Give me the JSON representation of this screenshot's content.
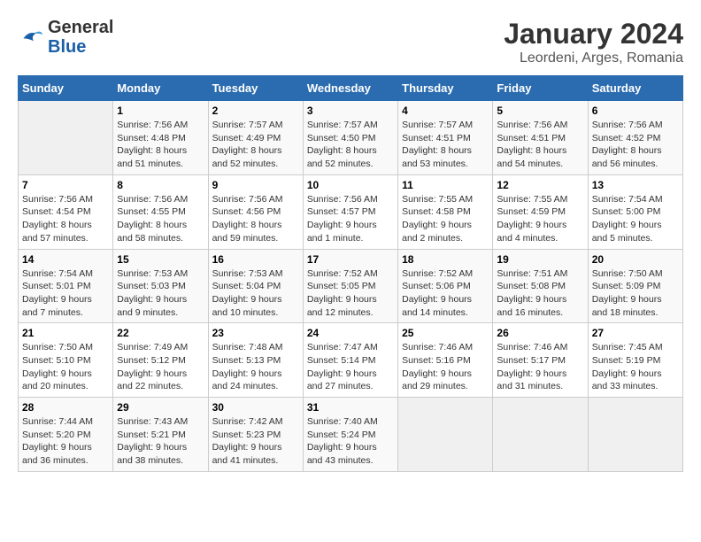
{
  "app": {
    "logo_line1": "General",
    "logo_line2": "Blue",
    "title": "January 2024",
    "subtitle": "Leordeni, Arges, Romania"
  },
  "calendar": {
    "headers": [
      "Sunday",
      "Monday",
      "Tuesday",
      "Wednesday",
      "Thursday",
      "Friday",
      "Saturday"
    ],
    "weeks": [
      [
        {
          "day": "",
          "info": ""
        },
        {
          "day": "1",
          "info": "Sunrise: 7:56 AM\nSunset: 4:48 PM\nDaylight: 8 hours\nand 51 minutes."
        },
        {
          "day": "2",
          "info": "Sunrise: 7:57 AM\nSunset: 4:49 PM\nDaylight: 8 hours\nand 52 minutes."
        },
        {
          "day": "3",
          "info": "Sunrise: 7:57 AM\nSunset: 4:50 PM\nDaylight: 8 hours\nand 52 minutes."
        },
        {
          "day": "4",
          "info": "Sunrise: 7:57 AM\nSunset: 4:51 PM\nDaylight: 8 hours\nand 53 minutes."
        },
        {
          "day": "5",
          "info": "Sunrise: 7:56 AM\nSunset: 4:51 PM\nDaylight: 8 hours\nand 54 minutes."
        },
        {
          "day": "6",
          "info": "Sunrise: 7:56 AM\nSunset: 4:52 PM\nDaylight: 8 hours\nand 56 minutes."
        }
      ],
      [
        {
          "day": "7",
          "info": "Sunrise: 7:56 AM\nSunset: 4:54 PM\nDaylight: 8 hours\nand 57 minutes."
        },
        {
          "day": "8",
          "info": "Sunrise: 7:56 AM\nSunset: 4:55 PM\nDaylight: 8 hours\nand 58 minutes."
        },
        {
          "day": "9",
          "info": "Sunrise: 7:56 AM\nSunset: 4:56 PM\nDaylight: 8 hours\nand 59 minutes."
        },
        {
          "day": "10",
          "info": "Sunrise: 7:56 AM\nSunset: 4:57 PM\nDaylight: 9 hours\nand 1 minute."
        },
        {
          "day": "11",
          "info": "Sunrise: 7:55 AM\nSunset: 4:58 PM\nDaylight: 9 hours\nand 2 minutes."
        },
        {
          "day": "12",
          "info": "Sunrise: 7:55 AM\nSunset: 4:59 PM\nDaylight: 9 hours\nand 4 minutes."
        },
        {
          "day": "13",
          "info": "Sunrise: 7:54 AM\nSunset: 5:00 PM\nDaylight: 9 hours\nand 5 minutes."
        }
      ],
      [
        {
          "day": "14",
          "info": "Sunrise: 7:54 AM\nSunset: 5:01 PM\nDaylight: 9 hours\nand 7 minutes."
        },
        {
          "day": "15",
          "info": "Sunrise: 7:53 AM\nSunset: 5:03 PM\nDaylight: 9 hours\nand 9 minutes."
        },
        {
          "day": "16",
          "info": "Sunrise: 7:53 AM\nSunset: 5:04 PM\nDaylight: 9 hours\nand 10 minutes."
        },
        {
          "day": "17",
          "info": "Sunrise: 7:52 AM\nSunset: 5:05 PM\nDaylight: 9 hours\nand 12 minutes."
        },
        {
          "day": "18",
          "info": "Sunrise: 7:52 AM\nSunset: 5:06 PM\nDaylight: 9 hours\nand 14 minutes."
        },
        {
          "day": "19",
          "info": "Sunrise: 7:51 AM\nSunset: 5:08 PM\nDaylight: 9 hours\nand 16 minutes."
        },
        {
          "day": "20",
          "info": "Sunrise: 7:50 AM\nSunset: 5:09 PM\nDaylight: 9 hours\nand 18 minutes."
        }
      ],
      [
        {
          "day": "21",
          "info": "Sunrise: 7:50 AM\nSunset: 5:10 PM\nDaylight: 9 hours\nand 20 minutes."
        },
        {
          "day": "22",
          "info": "Sunrise: 7:49 AM\nSunset: 5:12 PM\nDaylight: 9 hours\nand 22 minutes."
        },
        {
          "day": "23",
          "info": "Sunrise: 7:48 AM\nSunset: 5:13 PM\nDaylight: 9 hours\nand 24 minutes."
        },
        {
          "day": "24",
          "info": "Sunrise: 7:47 AM\nSunset: 5:14 PM\nDaylight: 9 hours\nand 27 minutes."
        },
        {
          "day": "25",
          "info": "Sunrise: 7:46 AM\nSunset: 5:16 PM\nDaylight: 9 hours\nand 29 minutes."
        },
        {
          "day": "26",
          "info": "Sunrise: 7:46 AM\nSunset: 5:17 PM\nDaylight: 9 hours\nand 31 minutes."
        },
        {
          "day": "27",
          "info": "Sunrise: 7:45 AM\nSunset: 5:19 PM\nDaylight: 9 hours\nand 33 minutes."
        }
      ],
      [
        {
          "day": "28",
          "info": "Sunrise: 7:44 AM\nSunset: 5:20 PM\nDaylight: 9 hours\nand 36 minutes."
        },
        {
          "day": "29",
          "info": "Sunrise: 7:43 AM\nSunset: 5:21 PM\nDaylight: 9 hours\nand 38 minutes."
        },
        {
          "day": "30",
          "info": "Sunrise: 7:42 AM\nSunset: 5:23 PM\nDaylight: 9 hours\nand 41 minutes."
        },
        {
          "day": "31",
          "info": "Sunrise: 7:40 AM\nSunset: 5:24 PM\nDaylight: 9 hours\nand 43 minutes."
        },
        {
          "day": "",
          "info": ""
        },
        {
          "day": "",
          "info": ""
        },
        {
          "day": "",
          "info": ""
        }
      ]
    ]
  }
}
